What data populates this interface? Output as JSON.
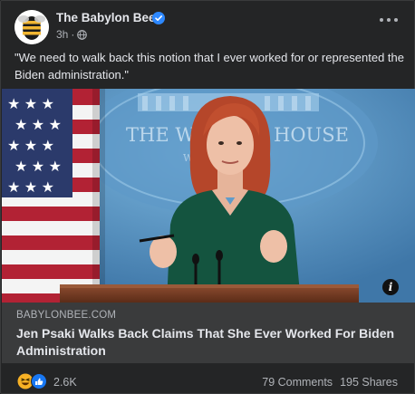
{
  "post": {
    "page_name": "The Babylon Bee",
    "time": "3h",
    "privacy_icon": "globe-icon",
    "verified_icon": "verified-badge-icon",
    "text": "\"We need to walk back this notion that I ever worked for or represented the Biden administration.\"",
    "photo_backdrop_text": "THE WHITE HOUSE",
    "photo_backdrop_text_left": "THE W",
    "photo_backdrop_text_right": "HOUSE",
    "photo_backdrop_text_sub": "W"
  },
  "link": {
    "domain": "BABYLONBEE.COM",
    "title": "Jen Psaki Walks Back Claims That She Ever Worked For Biden Administration"
  },
  "footer": {
    "reaction_count": "2.6K",
    "comments": "79 Comments",
    "shares": "195 Shares"
  },
  "colors": {
    "card_bg": "#242526",
    "link_bg": "#3a3b3c",
    "verified": "#2d88ff",
    "like": "#1877f2",
    "haha": "#f7b125"
  }
}
